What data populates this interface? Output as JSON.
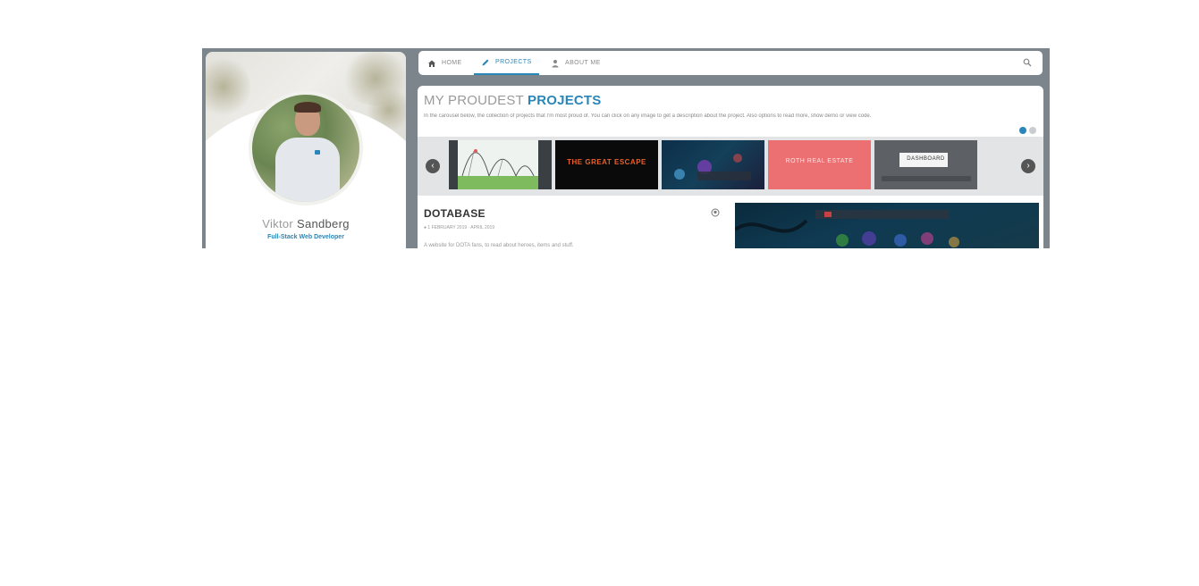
{
  "nav": {
    "items": [
      {
        "label": "HOME",
        "icon": "home-icon",
        "active": false
      },
      {
        "label": "PROJECTS",
        "icon": "pencil-icon",
        "active": true
      },
      {
        "label": "ABOUT ME",
        "icon": "person-icon",
        "active": false
      }
    ]
  },
  "profile": {
    "first_name": "Viktor",
    "last_name": "Sandberg",
    "title": "Full-Stack Web Developer"
  },
  "section": {
    "title_prefix": "MY PROUDEST",
    "title_accent": "PROJECTS",
    "description": "In the carousel below, the collection of projects that I'm most proud of. You can click on any image to get a description about the project. Also options to read more, show demo or view code.",
    "pager": {
      "count": 2,
      "active_index": 0
    }
  },
  "carousel": {
    "thumbnails": [
      {
        "name": "roller-coaster-thumbnail",
        "text": ""
      },
      {
        "name": "great-escape-thumbnail",
        "text": "THE GREAT ESCAPE"
      },
      {
        "name": "dark-game-thumbnail",
        "text": ""
      },
      {
        "name": "pink-project-thumbnail",
        "text": "ROTH REAL ESTATE"
      },
      {
        "name": "dashboard-thumbnail",
        "text": "DASHBOARD"
      }
    ]
  },
  "project": {
    "title": "DOTABASE",
    "meta": "● 1 FEBRUARY 2019 · APRIL 2019",
    "description": "A website for DOTA fans, to read about heroes, items and stuff."
  },
  "colors": {
    "accent": "#2a86b8",
    "frame": "#7d858c",
    "pink_thumb": "#ec6f72"
  }
}
